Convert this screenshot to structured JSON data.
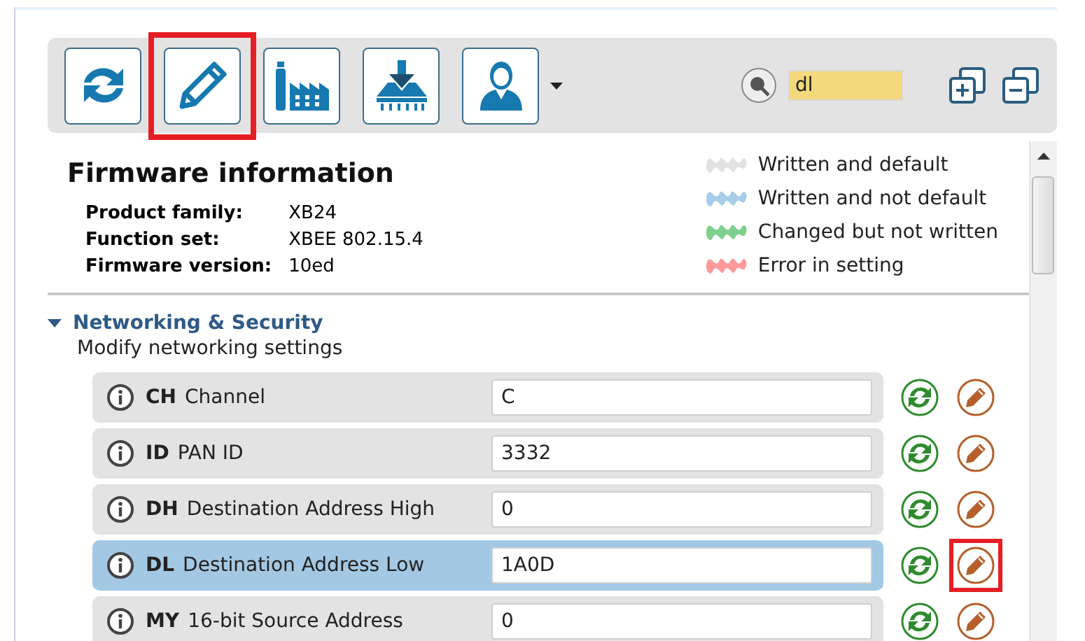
{
  "toolbar": {
    "buttons": [
      {
        "kind": "read",
        "highlighted": false
      },
      {
        "kind": "write",
        "highlighted": true
      },
      {
        "kind": "default",
        "highlighted": false
      },
      {
        "kind": "update",
        "highlighted": false
      },
      {
        "kind": "profile",
        "highlighted": false
      }
    ],
    "search": {
      "value": "dl"
    }
  },
  "firmware": {
    "title": "Firmware information",
    "fields": [
      {
        "label": "Product family:",
        "value": "XB24"
      },
      {
        "label": "Function set:",
        "value": "XBEE 802.15.4"
      },
      {
        "label": "Firmware version:",
        "value": "10ed"
      }
    ]
  },
  "legend": [
    {
      "label": "Written and default",
      "color": "#e2e2e2"
    },
    {
      "label": "Written and not default",
      "color": "#a8cde8"
    },
    {
      "label": "Changed but not written",
      "color": "#7ed08f"
    },
    {
      "label": "Error in setting",
      "color": "#ff9a9a"
    }
  ],
  "section": {
    "title": "Networking & Security",
    "expanded": true,
    "description": "Modify networking settings",
    "settings": [
      {
        "code": "CH",
        "name": "Channel",
        "value": "C",
        "selected": false,
        "write_highlighted": false
      },
      {
        "code": "ID",
        "name": "PAN ID",
        "value": "3332",
        "selected": false,
        "write_highlighted": false
      },
      {
        "code": "DH",
        "name": "Destination Address High",
        "value": "0",
        "selected": false,
        "write_highlighted": false
      },
      {
        "code": "DL",
        "name": "Destination Address Low",
        "value": "1A0D",
        "selected": true,
        "write_highlighted": true
      },
      {
        "code": "MY",
        "name": "16-bit Source Address",
        "value": "0",
        "selected": false,
        "write_highlighted": false
      }
    ]
  }
}
